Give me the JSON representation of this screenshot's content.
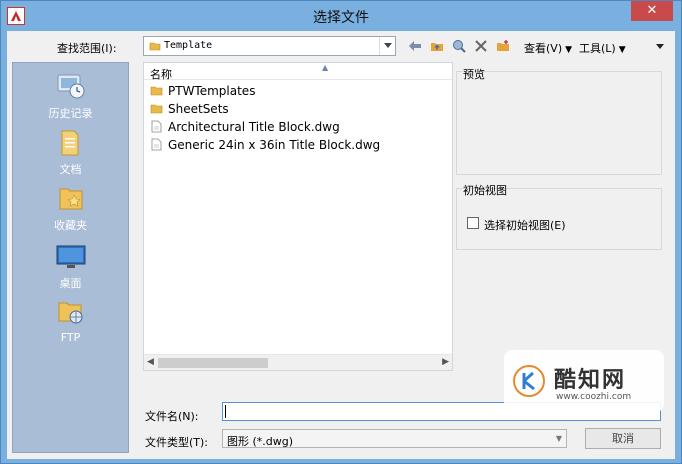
{
  "window": {
    "title": "选择文件",
    "close_glyph": "✕"
  },
  "toolbar": {
    "lookin_label": "查找范围(I):",
    "lookin_value": "Template",
    "view_label": "查看(V)",
    "tools_label": "工具(L)"
  },
  "places": [
    {
      "label": "历史记录",
      "icon": "history-icon"
    },
    {
      "label": "文档",
      "icon": "documents-icon"
    },
    {
      "label": "收藏夹",
      "icon": "favorites-icon"
    },
    {
      "label": "桌面",
      "icon": "desktop-icon"
    },
    {
      "label": "FTP",
      "icon": "ftp-icon"
    }
  ],
  "filelist": {
    "column_name": "名称",
    "items": [
      {
        "name": "PTWTemplates",
        "type": "folder"
      },
      {
        "name": "SheetSets",
        "type": "folder"
      },
      {
        "name": "Architectural Title Block.dwg",
        "type": "file"
      },
      {
        "name": "Generic 24in x 36in Title Block.dwg",
        "type": "file"
      }
    ]
  },
  "preview": {
    "label": "预览"
  },
  "initial_view": {
    "group_label": "初始视图",
    "checkbox_label": "选择初始视图(E)",
    "checked": false
  },
  "filename": {
    "label": "文件名(N):",
    "value": ""
  },
  "filetype": {
    "label": "文件类型(T):",
    "value": "图形 (*.dwg)"
  },
  "buttons": {
    "cancel": "取消"
  },
  "watermark": {
    "name": "酷知网",
    "url": "www.coozhi.com"
  }
}
